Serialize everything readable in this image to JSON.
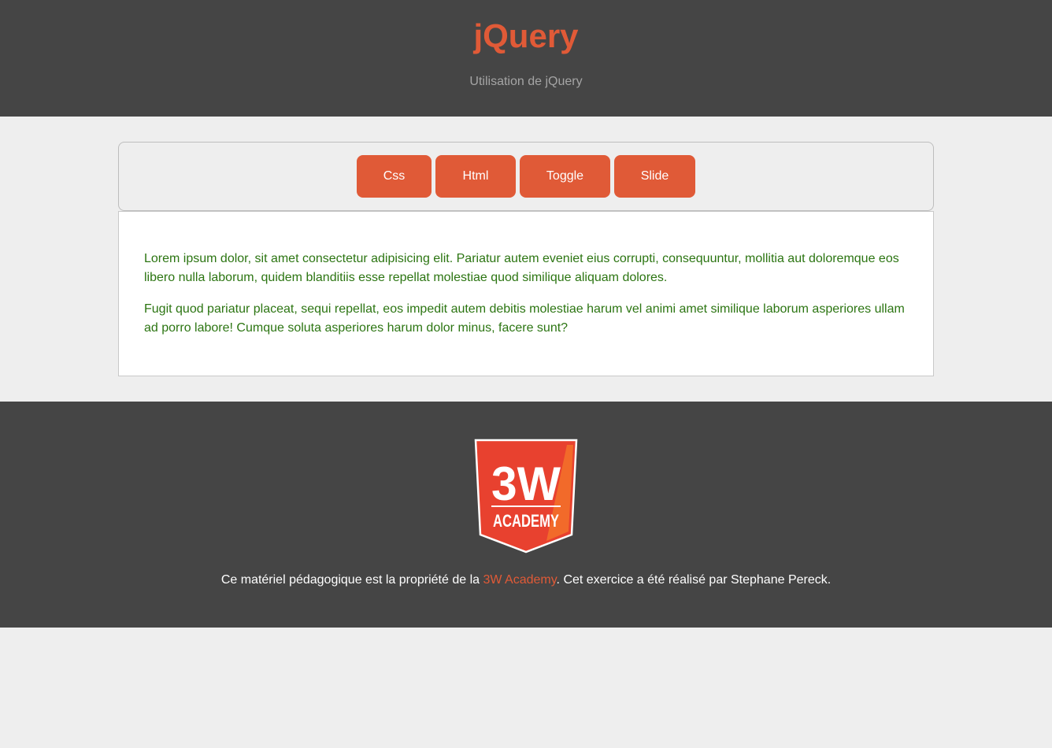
{
  "header": {
    "title": "jQuery",
    "subtitle": "Utilisation de jQuery"
  },
  "toolbar": {
    "buttons": [
      {
        "label": "Css"
      },
      {
        "label": "Html"
      },
      {
        "label": "Toggle"
      },
      {
        "label": "Slide"
      }
    ]
  },
  "content": {
    "paragraphs": [
      "Lorem ipsum dolor, sit amet consectetur adipisicing elit. Pariatur autem eveniet eius corrupti, consequuntur, mollitia aut doloremque eos libero nulla laborum, quidem blanditiis esse repellat molestiae quod similique aliquam dolores.",
      "Fugit quod pariatur placeat, sequi repellat, eos impedit autem debitis molestiae harum vel animi amet similique laborum asperiores ullam ad porro labore! Cumque soluta asperiores harum dolor minus, facere sunt?"
    ]
  },
  "footer": {
    "logo_top": "3W",
    "logo_bottom": "ACADEMY",
    "text_before": "Ce matériel pédagogique est la propriété de la ",
    "link_label": "3W Academy",
    "text_after": ". Cet exercice a été réalisé par Stephane Pereck."
  },
  "colors": {
    "header_bg": "#454545",
    "accent": "#e05a37",
    "page_bg": "#eeeeee",
    "content_text": "#2c7512"
  }
}
